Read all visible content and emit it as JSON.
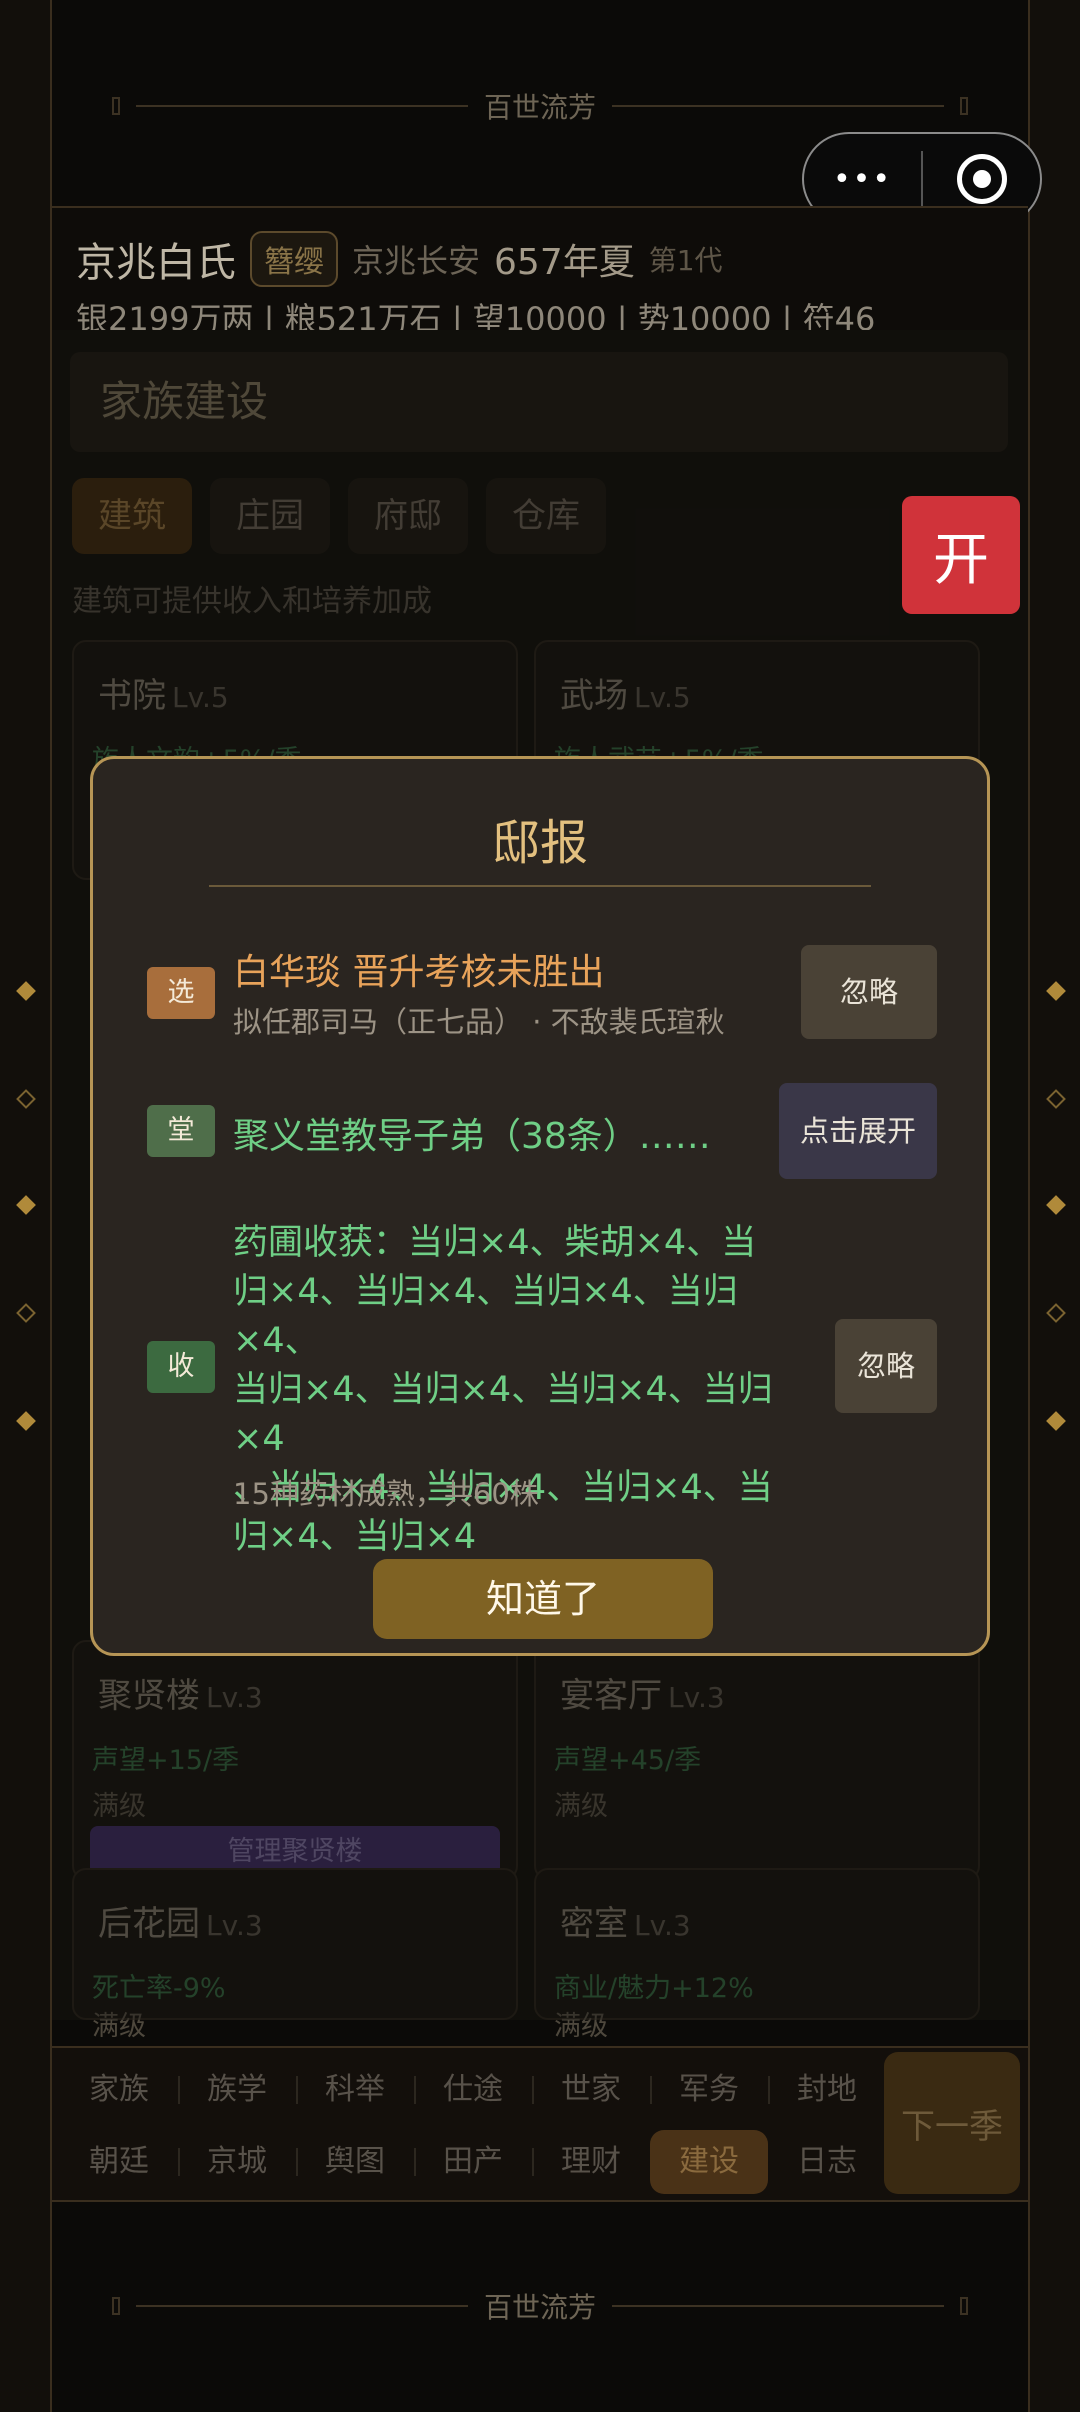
{
  "top_banner": {
    "text": "百世流芳"
  },
  "capsule": {
    "more_glyph": "•••",
    "close_icon": "target-icon"
  },
  "header": {
    "clan_name": "京兆白氏",
    "badge": "簪缨",
    "location": "京兆长安",
    "year": "657年夏",
    "generation": "第1代",
    "resources": "银2199万两 | 粮521万石 | 望10000 | 势10000 | 符46"
  },
  "content": {
    "section_title": "家族建设",
    "tabs": [
      "建筑",
      "庄园",
      "府邸",
      "仓库"
    ],
    "active_tab": "建筑",
    "hint": "建筑可提供收入和培养加成",
    "cards": [
      {
        "name": "书院",
        "level": "Lv.5",
        "effect": "族人文韵+5%/季"
      },
      {
        "name": "武场",
        "level": "Lv.5",
        "effect": "族人武艺+5%/季"
      },
      {
        "name": "聚贤楼",
        "level": "Lv.3",
        "effect": "声望+15/季",
        "status": "满级",
        "button": "管理聚贤楼"
      },
      {
        "name": "宴客厅",
        "level": "Lv.3",
        "effect": "声望+45/季",
        "status": "满级"
      },
      {
        "name": "后花园",
        "level": "Lv.3",
        "effect": "死亡率-9%",
        "status": "满级"
      },
      {
        "name": "密室",
        "level": "Lv.3",
        "effect": "商业/魅力+12%",
        "status": "满级"
      }
    ]
  },
  "open_button": {
    "label": "开"
  },
  "modal": {
    "title": "邸报",
    "items": [
      {
        "tag": "选",
        "title": "白华琰 晋升考核未胜出",
        "subtitle": "拟任郡司马（正七品） · 不敌裴氏瑄秋",
        "button": "忽略",
        "title_color": "#e8a35a"
      },
      {
        "tag": "堂",
        "title": "聚义堂教导子弟（38条）……",
        "button": "点击展开",
        "title_color": "#6fcf86"
      },
      {
        "tag": "收",
        "title_lines": [
          "药圃收获：当归×4、柴胡×4、当",
          "归×4、当归×4、当归×4、当归×4、",
          "当归×4、当归×4、当归×4、当归×4",
          "、当归×4、当归×4、当归×4、当",
          "归×4、当归×4"
        ],
        "subtitle": "15种药材成熟，共60株",
        "button": "忽略",
        "title_color": "#6fcf86"
      }
    ],
    "confirm": "知道了"
  },
  "bottom_nav": {
    "row1": [
      "家族",
      "族学",
      "科举",
      "仕途",
      "世家",
      "军务",
      "封地"
    ],
    "row2": [
      "朝廷",
      "京城",
      "舆图",
      "田产",
      "理财",
      "建设",
      "日志"
    ],
    "active": "建设",
    "next_season": "下一季"
  },
  "bottom_banner": {
    "text": "百世流芳"
  }
}
